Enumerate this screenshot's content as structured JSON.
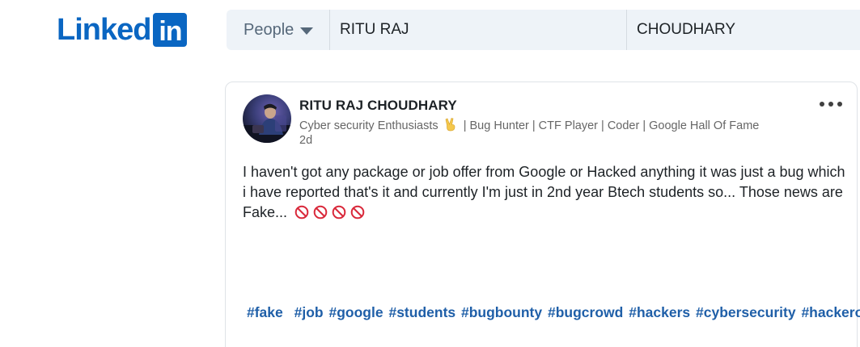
{
  "header": {
    "logo_text": "Linked",
    "logo_box": "in",
    "search_type": "People",
    "first_name_value": "RITU RAJ",
    "last_name_value": "CHOUDHARY"
  },
  "post": {
    "author_name": "RITU RAJ CHOUDHARY",
    "headline_before_emoji": "Cyber security Enthusiasts",
    "headline_after_emoji": "| Bug Hunter | CTF Player | Coder | Google Hall Of Fame",
    "timestamp": "2d",
    "body": "I haven't got any package or job offer from Google or Hacked anything  it was just a bug which i have reported that's it and currently I'm just in 2nd year Btech students so... Those news are Fake...",
    "hashtags": [
      "#fake",
      "#job",
      "#google",
      "#students",
      "#bugbounty",
      "#bugcrowd",
      "#hackers",
      "#cybersecurity",
      "#hackerone"
    ],
    "emoji_icons": [
      "victory-hand-icon",
      "no-entry-icon",
      "no-entry-icon",
      "no-entry-icon",
      "no-entry-icon"
    ]
  },
  "colors": {
    "brand": "#0a66c2",
    "search_bg": "#eef3f8",
    "hashtag": "#1f5fa8",
    "no_entry": "#d9283a"
  }
}
